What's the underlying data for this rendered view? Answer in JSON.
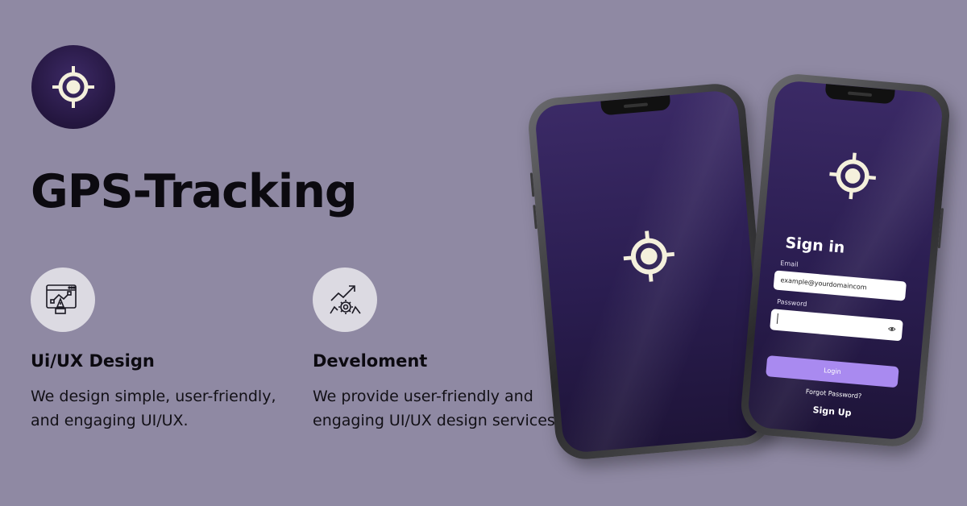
{
  "headline": "GPS-Tracking",
  "features": [
    {
      "title": "Ui/UX Design",
      "description_line1": "We design simple, user-friendly,",
      "description_line2": "and engaging UI/UX.",
      "icon": "ui-design-icon"
    },
    {
      "title": "Develoment",
      "description_line1": "We provide user-friendly and",
      "description_line2": "engaging UI/UX design services.",
      "icon": "development-icon"
    }
  ],
  "signin": {
    "title": "Sign in",
    "email_label": "Email",
    "email_value": "example@yourdomaincom",
    "password_label": "Password",
    "login_label": "Login",
    "forgot_label": "Forgot Password?",
    "signup_label": "Sign Up"
  },
  "colors": {
    "background": "#8f89a3",
    "brand_purple": "#2a1d50",
    "accent_button": "#a98af0",
    "logo_mark": "#f4f0dc"
  }
}
